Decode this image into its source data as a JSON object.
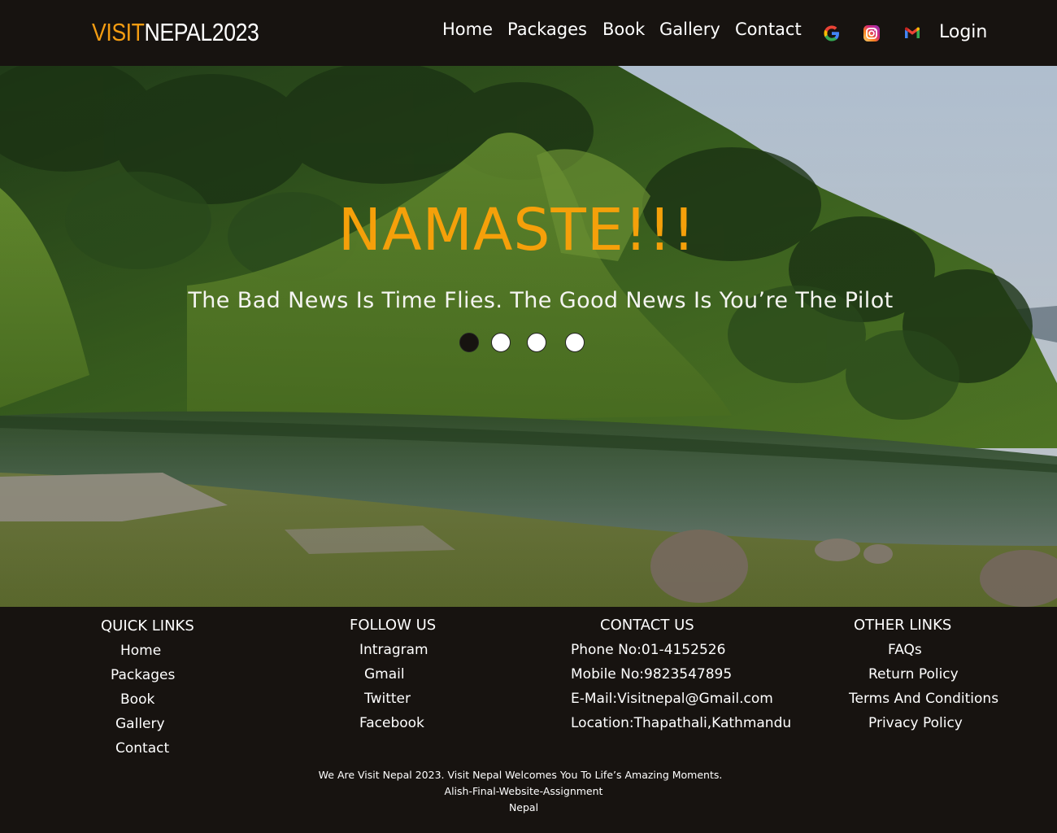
{
  "brand": {
    "part1": "VISIT",
    "part2": "NEPAL2023"
  },
  "nav": {
    "items": [
      "Home",
      "Packages",
      "Book",
      "Gallery",
      "Contact"
    ],
    "social_icons": [
      "google-icon",
      "instagram-icon",
      "gmail-icon"
    ],
    "login_label": "Login"
  },
  "hero": {
    "title": "NAMASTE!!!",
    "subtitle": "The Bad News Is Time Flies. The Good News Is You’re The Pilot",
    "slides": 4,
    "active_slide": 1
  },
  "footer": {
    "quick_links": {
      "title": "QUICK LINKS",
      "items": [
        "Home",
        "Packages",
        "Book",
        "Gallery",
        "Contact"
      ]
    },
    "follow_us": {
      "title": "FOLLOW US",
      "items": [
        "Intragram",
        "Gmail",
        "Twitter",
        "Facebook"
      ]
    },
    "contact_us": {
      "title": "CONTACT US",
      "items": [
        "Phone No:01-4152526",
        "Mobile No:9823547895",
        "E-Mail:Visitnepal@Gmail.com",
        "Location:Thapathali,Kathmandu"
      ]
    },
    "other_links": {
      "title": "OTHER LINKS",
      "items": [
        "FAQs",
        "Return Policy",
        "Terms And Conditions",
        "Privacy Policy"
      ]
    },
    "fine_print": [
      "We Are Visit Nepal 2023. Visit Nepal Welcomes You To Life’s Amazing Moments.",
      "Alish-Final-Website-Assignment",
      "Nepal"
    ]
  },
  "colors": {
    "brand_orange": "#f39c12",
    "background": "#171310",
    "text": "#ffffff"
  }
}
